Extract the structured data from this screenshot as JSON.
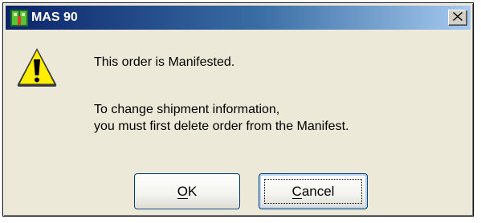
{
  "window": {
    "title": "MAS 90"
  },
  "message": {
    "line1": "This order is Manifested.",
    "line2": "To change shipment information,",
    "line3": "you must first delete order from the Manifest."
  },
  "buttons": {
    "ok": {
      "accel": "O",
      "rest": "K"
    },
    "cancel": {
      "accel": "C",
      "rest": "ancel"
    }
  },
  "icons": {
    "app": "mas90-app-icon",
    "warning": "warning-triangle-icon",
    "close": "close-icon"
  },
  "colors": {
    "titlebar_start": "#0a246a",
    "titlebar_end": "#a6caf0",
    "dialog_bg": "#ece9d8",
    "warning_yellow": "#ffee00"
  }
}
